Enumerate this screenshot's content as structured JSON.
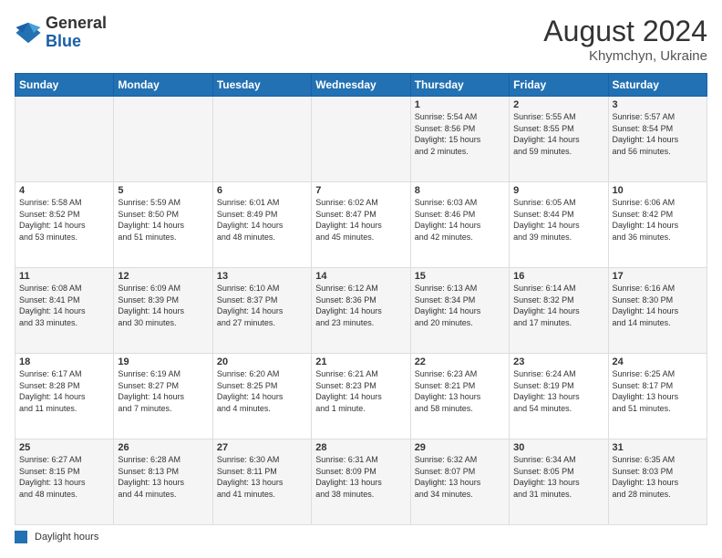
{
  "logo": {
    "general": "General",
    "blue": "Blue"
  },
  "title": "August 2024",
  "subtitle": "Khymchyn, Ukraine",
  "days_of_week": [
    "Sunday",
    "Monday",
    "Tuesday",
    "Wednesday",
    "Thursday",
    "Friday",
    "Saturday"
  ],
  "footer_legend": "Daylight hours",
  "weeks": [
    [
      {
        "day": "",
        "info": ""
      },
      {
        "day": "",
        "info": ""
      },
      {
        "day": "",
        "info": ""
      },
      {
        "day": "",
        "info": ""
      },
      {
        "day": "1",
        "info": "Sunrise: 5:54 AM\nSunset: 8:56 PM\nDaylight: 15 hours\nand 2 minutes."
      },
      {
        "day": "2",
        "info": "Sunrise: 5:55 AM\nSunset: 8:55 PM\nDaylight: 14 hours\nand 59 minutes."
      },
      {
        "day": "3",
        "info": "Sunrise: 5:57 AM\nSunset: 8:54 PM\nDaylight: 14 hours\nand 56 minutes."
      }
    ],
    [
      {
        "day": "4",
        "info": "Sunrise: 5:58 AM\nSunset: 8:52 PM\nDaylight: 14 hours\nand 53 minutes."
      },
      {
        "day": "5",
        "info": "Sunrise: 5:59 AM\nSunset: 8:50 PM\nDaylight: 14 hours\nand 51 minutes."
      },
      {
        "day": "6",
        "info": "Sunrise: 6:01 AM\nSunset: 8:49 PM\nDaylight: 14 hours\nand 48 minutes."
      },
      {
        "day": "7",
        "info": "Sunrise: 6:02 AM\nSunset: 8:47 PM\nDaylight: 14 hours\nand 45 minutes."
      },
      {
        "day": "8",
        "info": "Sunrise: 6:03 AM\nSunset: 8:46 PM\nDaylight: 14 hours\nand 42 minutes."
      },
      {
        "day": "9",
        "info": "Sunrise: 6:05 AM\nSunset: 8:44 PM\nDaylight: 14 hours\nand 39 minutes."
      },
      {
        "day": "10",
        "info": "Sunrise: 6:06 AM\nSunset: 8:42 PM\nDaylight: 14 hours\nand 36 minutes."
      }
    ],
    [
      {
        "day": "11",
        "info": "Sunrise: 6:08 AM\nSunset: 8:41 PM\nDaylight: 14 hours\nand 33 minutes."
      },
      {
        "day": "12",
        "info": "Sunrise: 6:09 AM\nSunset: 8:39 PM\nDaylight: 14 hours\nand 30 minutes."
      },
      {
        "day": "13",
        "info": "Sunrise: 6:10 AM\nSunset: 8:37 PM\nDaylight: 14 hours\nand 27 minutes."
      },
      {
        "day": "14",
        "info": "Sunrise: 6:12 AM\nSunset: 8:36 PM\nDaylight: 14 hours\nand 23 minutes."
      },
      {
        "day": "15",
        "info": "Sunrise: 6:13 AM\nSunset: 8:34 PM\nDaylight: 14 hours\nand 20 minutes."
      },
      {
        "day": "16",
        "info": "Sunrise: 6:14 AM\nSunset: 8:32 PM\nDaylight: 14 hours\nand 17 minutes."
      },
      {
        "day": "17",
        "info": "Sunrise: 6:16 AM\nSunset: 8:30 PM\nDaylight: 14 hours\nand 14 minutes."
      }
    ],
    [
      {
        "day": "18",
        "info": "Sunrise: 6:17 AM\nSunset: 8:28 PM\nDaylight: 14 hours\nand 11 minutes."
      },
      {
        "day": "19",
        "info": "Sunrise: 6:19 AM\nSunset: 8:27 PM\nDaylight: 14 hours\nand 7 minutes."
      },
      {
        "day": "20",
        "info": "Sunrise: 6:20 AM\nSunset: 8:25 PM\nDaylight: 14 hours\nand 4 minutes."
      },
      {
        "day": "21",
        "info": "Sunrise: 6:21 AM\nSunset: 8:23 PM\nDaylight: 14 hours\nand 1 minute."
      },
      {
        "day": "22",
        "info": "Sunrise: 6:23 AM\nSunset: 8:21 PM\nDaylight: 13 hours\nand 58 minutes."
      },
      {
        "day": "23",
        "info": "Sunrise: 6:24 AM\nSunset: 8:19 PM\nDaylight: 13 hours\nand 54 minutes."
      },
      {
        "day": "24",
        "info": "Sunrise: 6:25 AM\nSunset: 8:17 PM\nDaylight: 13 hours\nand 51 minutes."
      }
    ],
    [
      {
        "day": "25",
        "info": "Sunrise: 6:27 AM\nSunset: 8:15 PM\nDaylight: 13 hours\nand 48 minutes."
      },
      {
        "day": "26",
        "info": "Sunrise: 6:28 AM\nSunset: 8:13 PM\nDaylight: 13 hours\nand 44 minutes."
      },
      {
        "day": "27",
        "info": "Sunrise: 6:30 AM\nSunset: 8:11 PM\nDaylight: 13 hours\nand 41 minutes."
      },
      {
        "day": "28",
        "info": "Sunrise: 6:31 AM\nSunset: 8:09 PM\nDaylight: 13 hours\nand 38 minutes."
      },
      {
        "day": "29",
        "info": "Sunrise: 6:32 AM\nSunset: 8:07 PM\nDaylight: 13 hours\nand 34 minutes."
      },
      {
        "day": "30",
        "info": "Sunrise: 6:34 AM\nSunset: 8:05 PM\nDaylight: 13 hours\nand 31 minutes."
      },
      {
        "day": "31",
        "info": "Sunrise: 6:35 AM\nSunset: 8:03 PM\nDaylight: 13 hours\nand 28 minutes."
      }
    ]
  ]
}
